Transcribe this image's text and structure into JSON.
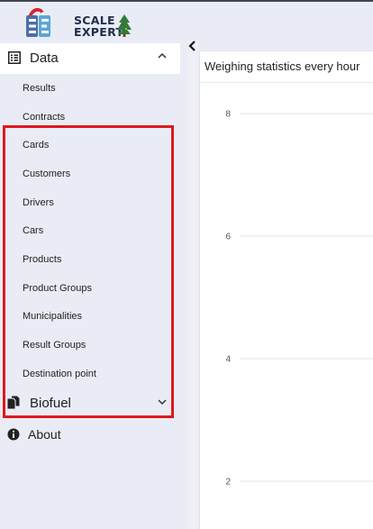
{
  "logo": {
    "line1": "SCALE",
    "line2": "EXPERT",
    "icon": "scale-expert-logo-icon",
    "decorations": [
      "santa-hat-icon",
      "christmas-tree-icon"
    ]
  },
  "sidebar": {
    "collapse_icon": "chevron-left-icon",
    "data_group": {
      "label": "Data",
      "icon": "list-icon",
      "state_icon": "chevron-up-icon",
      "items": [
        {
          "label": "Results"
        },
        {
          "label": "Contracts"
        },
        {
          "label": "Cards"
        },
        {
          "label": "Customers"
        },
        {
          "label": "Drivers"
        },
        {
          "label": "Cars"
        },
        {
          "label": "Products"
        },
        {
          "label": "Product Groups"
        },
        {
          "label": "Municipalities"
        },
        {
          "label": "Result Groups"
        },
        {
          "label": "Destination point"
        }
      ]
    },
    "biofuel_group": {
      "label": "Biofuel",
      "icon": "copy-icon",
      "state_icon": "chevron-down-icon"
    },
    "about": {
      "label": "About",
      "icon": "info-circle-icon"
    }
  },
  "panel": {
    "title": "Weighing statistics every hour"
  },
  "colors": {
    "highlight": "#e0181f",
    "sidebar_bg": "#e9ecf5",
    "panel_bg": "#ffffff",
    "topbar_line": "#3d4352",
    "gridline": "#e3e3e3"
  },
  "chart_data": {
    "type": "bar",
    "title": "Weighing statistics every hour",
    "y_ticks": [
      8,
      6,
      4,
      2
    ],
    "ylim": [
      0,
      8
    ],
    "grid": true,
    "series": []
  }
}
